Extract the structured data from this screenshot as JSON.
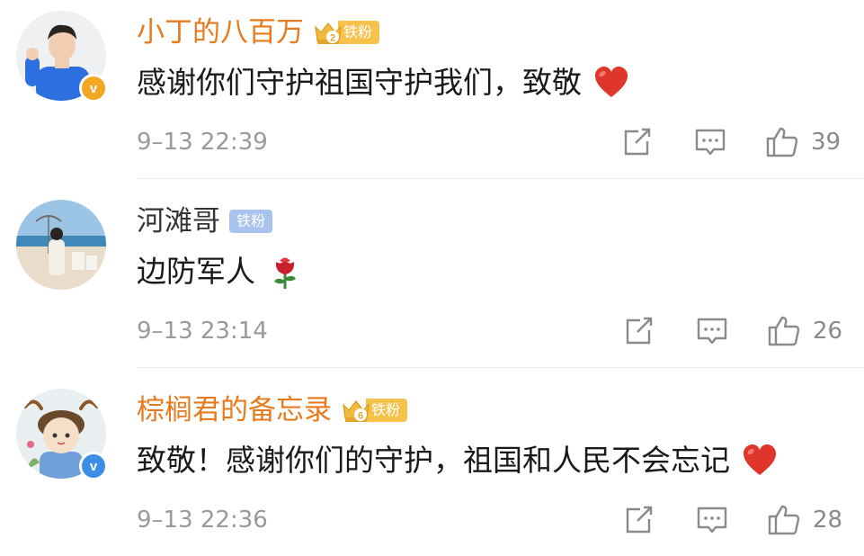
{
  "comments": [
    {
      "username": "小丁的八百万",
      "badge_label": "铁粉",
      "badge_level": "2",
      "text": "感谢你们守护祖国守护我们，致敬",
      "emoji": "red-heart",
      "time": "9–13 22:39",
      "likes": "39",
      "verified": "v"
    },
    {
      "username": "河滩哥",
      "badge_label": "铁粉",
      "text": "边防军人",
      "emoji": "rose",
      "time": "9–13 23:14",
      "likes": "26"
    },
    {
      "username": "棕榈君的备忘录",
      "badge_label": "铁粉",
      "badge_level": "6",
      "text": "致敬！感谢你们的守护，祖国和人民不会忘记",
      "emoji": "red-heart",
      "time": "9–13 22:36",
      "likes": "28",
      "verified": "v"
    }
  ],
  "colors": {
    "username_highlight": "#e77a1c",
    "badge_gold": "#f6c24b",
    "badge_blue": "#a9c3ef",
    "meta_gray": "#9a9a9a"
  }
}
